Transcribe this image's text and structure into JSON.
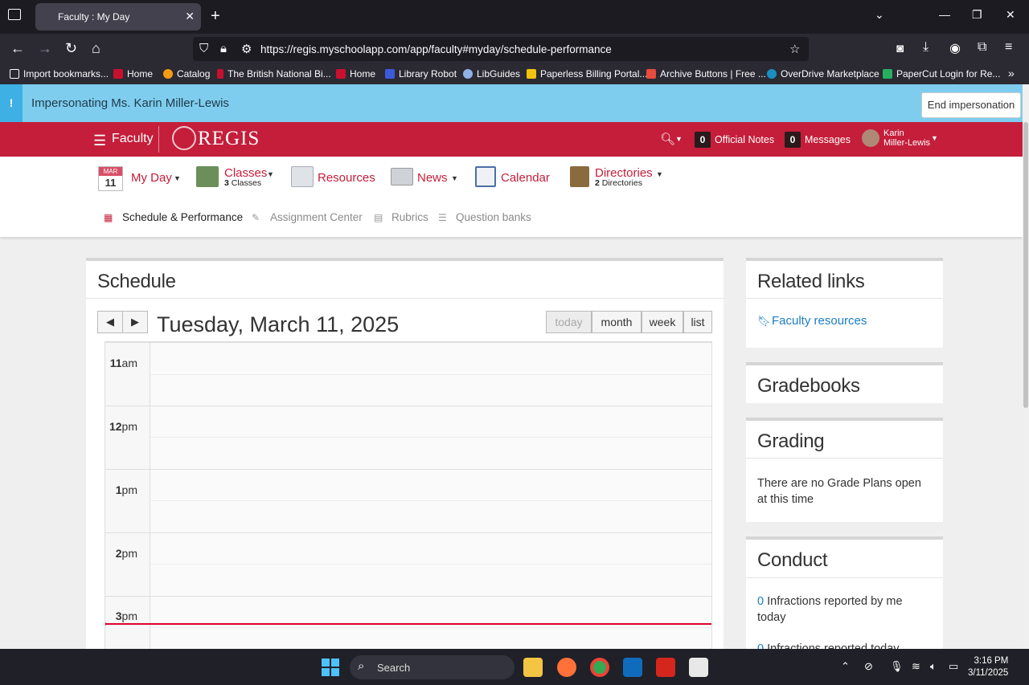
{
  "browser": {
    "tab_title": "Faculty : My Day",
    "url": "https://regis.myschoolapp.com/app/faculty#myday/schedule-performance",
    "bookmarks": [
      {
        "label": "Import bookmarks...",
        "color": "#fbfbfe"
      },
      {
        "label": "Home",
        "color": "#c8102e"
      },
      {
        "label": "Catalog",
        "color": "#f39c12"
      },
      {
        "label": "The British National Bi...",
        "color": "#c8102e"
      },
      {
        "label": "Home",
        "color": "#c8102e"
      },
      {
        "label": "Library Robot",
        "color": "#3b5bdb"
      },
      {
        "label": "LibGuides",
        "color": "#8fb3e6"
      },
      {
        "label": "Paperless Billing Portal...",
        "color": "#f1c40f"
      },
      {
        "label": "Archive Buttons | Free ...",
        "color": "#e74c3c"
      },
      {
        "label": "OverDrive Marketplace",
        "color": "#1a8fbf"
      },
      {
        "label": "PaperCut Login for Re...",
        "color": "#27ae60"
      }
    ]
  },
  "impersonation": {
    "text": "Impersonating Ms. Karin Miller-Lewis",
    "end_button": "End impersonation",
    "icon": "!"
  },
  "header": {
    "menu_label": "Faculty",
    "brand": "REGIS",
    "official_notes_count": "0",
    "official_notes_label": "Official Notes",
    "messages_count": "0",
    "messages_label": "Messages",
    "user_first": "Karin",
    "user_last": "Miller-Lewis"
  },
  "modules": {
    "myday_month": "MAR",
    "myday_day": "11",
    "myday_label": "My Day",
    "classes_label": "Classes",
    "classes_count": "3",
    "classes_sub": "Classes",
    "resources_label": "Resources",
    "news_label": "News",
    "calendar_label": "Calendar",
    "directories_label": "Directories",
    "directories_count": "2",
    "directories_sub": "Directories"
  },
  "subnav": {
    "schedule": "Schedule & Performance",
    "assignment": "Assignment Center",
    "rubrics": "Rubrics",
    "question_banks": "Question banks"
  },
  "schedule": {
    "title": "Schedule",
    "date": "Tuesday, March 11, 2025",
    "prev": "◀",
    "next": "▶",
    "views": {
      "today": "today",
      "month": "month",
      "week": "week",
      "list": "list"
    },
    "times": [
      {
        "hour": "11",
        "suffix": "am"
      },
      {
        "hour": "12",
        "suffix": "pm"
      },
      {
        "hour": "1",
        "suffix": "pm"
      },
      {
        "hour": "2",
        "suffix": "pm"
      },
      {
        "hour": "3",
        "suffix": "pm"
      }
    ]
  },
  "sidebar": {
    "related_title": "Related links",
    "related_link": "Faculty resources",
    "gradebooks_title": "Gradebooks",
    "grading_title": "Grading",
    "grading_text": "There are no Grade Plans open at this time",
    "conduct_title": "Conduct",
    "conduct_rows": [
      {
        "count": "0",
        "text": "Infractions reported by me today"
      },
      {
        "count": "0",
        "text": "Infractions reported today"
      }
    ]
  },
  "taskbar": {
    "search": "Search",
    "time": "3:16 PM",
    "date": "3/11/2025"
  },
  "colors": {
    "brand_red": "#c41e3a",
    "impersonation_blue": "#7fcdee",
    "link_blue": "#1b7dc4",
    "now_line": "#e0002a"
  }
}
